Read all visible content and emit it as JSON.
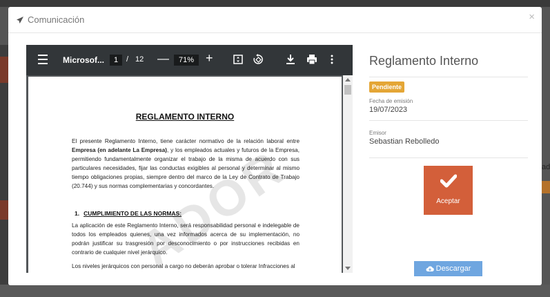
{
  "background": {
    "right_partial_text": "ad"
  },
  "modal": {
    "title": "Comunicación",
    "close_glyph": "×"
  },
  "viewer": {
    "file_name": "Microsof...",
    "current_page": "1",
    "page_separator": "/",
    "total_pages": "12",
    "zoom": "71%",
    "minus_glyph": "—",
    "plus_glyph": "+"
  },
  "document": {
    "title": "REGLAMENTO INTERNO",
    "paragraph1_before": "El presente Reglamento Interno, tiene carácter normativo de la relación laboral entre ",
    "paragraph1_bold": "Empresa (en adelante La Empresa)",
    "paragraph1_after": ", y los empleados actuales y futuros de la Empresa, permitiendo fundamentalmente organizar el trabajo de la misma de acuerdo con sus particulares necesidades, fijar las conductas exigibles al personal y determinar al mismo tiempo obligaciones propias, siempre dentro del marco de la Ley de Contrato de Trabajo (20.744) y sus normas complementarias y concordantes.",
    "section1_number": "1.",
    "section1_title": "CUMPLIMIENTO DE LAS NORMAS:",
    "paragraph2": "La aplicación de este Reglamento Interno, será responsabilidad personal e indelegable de todos los empleados quienes, una vez informados acerca de su implementación, no podrán justificar su trasgresión por desconocimiento o por instrucciones recibidas en contrario de cualquier nivel jerárquico.",
    "paragraph3": "Los niveles jerárquicos con personal a cargo no deberán aprobar o tolerar Infracciones al",
    "watermark": "ADOR"
  },
  "details": {
    "title": "Reglamento Interno",
    "status": "Pendiente",
    "date_label": "Fecha de emisión",
    "date_value": "19/07/2023",
    "issuer_label": "Emisor",
    "issuer_value": "Sebastian Rebolledo",
    "accept_label": "Aceptar",
    "download_label": "Descargar"
  },
  "colors": {
    "accept": "#d35f3a",
    "status_badge": "#e4a636",
    "download": "#6fa6e0",
    "toolbar": "#323639"
  }
}
